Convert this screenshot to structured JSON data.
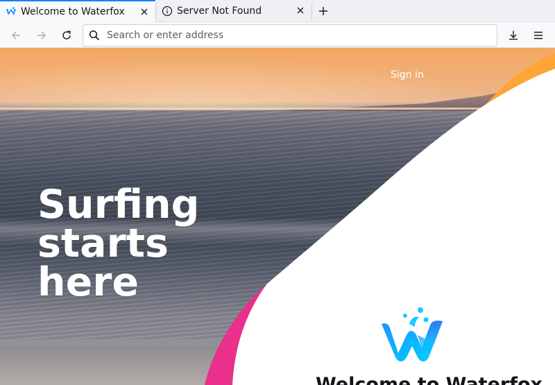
{
  "browser": {
    "tabs": [
      {
        "title": "Welcome to Waterfox",
        "icon": "waterfox-icon",
        "active": true
      },
      {
        "title": "Server Not Found",
        "icon": "info-icon",
        "active": false
      }
    ],
    "urlbar": {
      "placeholder": "Search or enter address",
      "value": ""
    },
    "accent_color": "#0a84ff"
  },
  "page": {
    "signin_label": "Sign in",
    "hero_lines": [
      "Surfing",
      "starts",
      "here"
    ],
    "welcome_title": "Welcome to Waterfox",
    "colors": {
      "orange": "#ffa436",
      "pink": "#e8308c",
      "logo_blue": "#1e90ff",
      "logo_cyan": "#00d4ff"
    }
  }
}
